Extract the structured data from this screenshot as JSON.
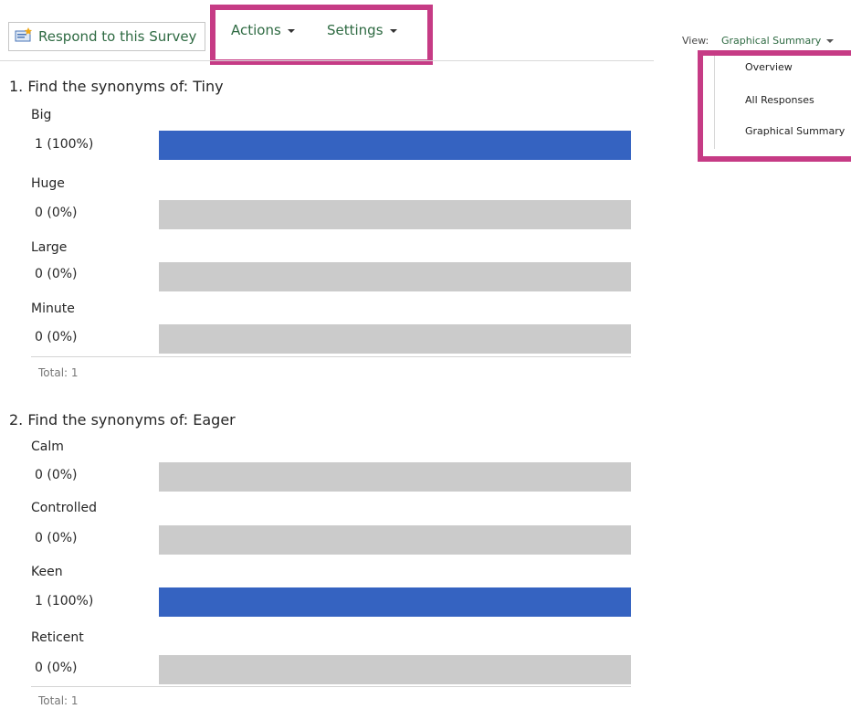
{
  "toolbar": {
    "respond_label": "Respond to this Survey",
    "actions_label": "Actions",
    "settings_label": "Settings",
    "view_label": "View:",
    "view_selected": "Graphical Summary"
  },
  "view_menu": [
    "Overview",
    "All Responses",
    "Graphical Summary"
  ],
  "questions": [
    {
      "title": "1. Find the synonyms of: Tiny",
      "options": [
        {
          "label": "Big",
          "count": "1 (100%)",
          "fraction": 1.0
        },
        {
          "label": "Huge",
          "count": "0 (0%)",
          "fraction": 0.0
        },
        {
          "label": "Large",
          "count": "0 (0%)",
          "fraction": 0.0
        },
        {
          "label": "Minute",
          "count": "0 (0%)",
          "fraction": 0.0
        }
      ],
      "total": "Total: 1"
    },
    {
      "title": "2. Find the synonyms of: Eager",
      "options": [
        {
          "label": "Calm",
          "count": "0 (0%)",
          "fraction": 0.0
        },
        {
          "label": "Controlled",
          "count": "0 (0%)",
          "fraction": 0.0
        },
        {
          "label": "Keen",
          "count": "1 (100%)",
          "fraction": 1.0
        },
        {
          "label": "Reticent",
          "count": "0 (0%)",
          "fraction": 0.0
        }
      ],
      "total": "Total: 1"
    }
  ],
  "colors": {
    "bar_fill": "#3563c1",
    "bar_track": "#cbcbcb",
    "highlight_border": "#c63b85",
    "link_text": "#2e6a42"
  }
}
